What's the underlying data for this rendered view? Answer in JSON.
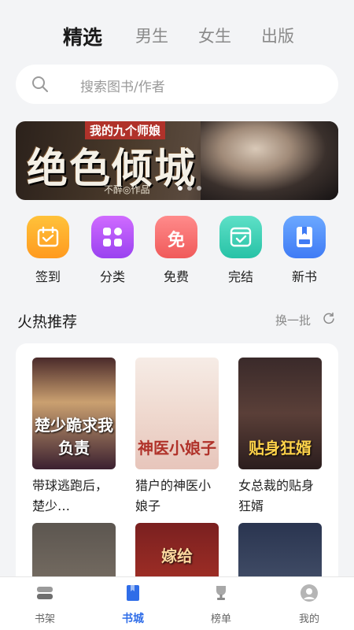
{
  "tabs": [
    "精选",
    "男生",
    "女生",
    "出版"
  ],
  "search": {
    "placeholder": "搜索图书/作者"
  },
  "banner": {
    "subtitle": "我的九个师娘",
    "title": "绝色倾城",
    "author": "不醉◎作品"
  },
  "quick": [
    {
      "label": "签到",
      "icon": "calendar-check-icon"
    },
    {
      "label": "分类",
      "icon": "grid-icon"
    },
    {
      "label": "免费",
      "icon": "free-icon",
      "glyph": "免"
    },
    {
      "label": "完结",
      "icon": "finished-icon"
    },
    {
      "label": "新书",
      "icon": "new-book-icon"
    }
  ],
  "section": {
    "title": "火热推荐",
    "swap": "换一批"
  },
  "books": [
    {
      "title": "带球逃跑后，楚少…",
      "cover_text": "楚少跪求我负责"
    },
    {
      "title": "猎户的神医小娘子",
      "cover_text": "神医小娘子"
    },
    {
      "title": "女总裁的贴身狂婿",
      "cover_text": "贴身狂婿"
    },
    {
      "title": "",
      "cover_text": ""
    },
    {
      "title": "",
      "cover_text": "嫁给"
    },
    {
      "title": "",
      "cover_text": ""
    }
  ],
  "nav": [
    "书架",
    "书城",
    "榜单",
    "我的"
  ],
  "colors": {
    "accent": "#2f6de8",
    "background": "#f3f4f6"
  }
}
